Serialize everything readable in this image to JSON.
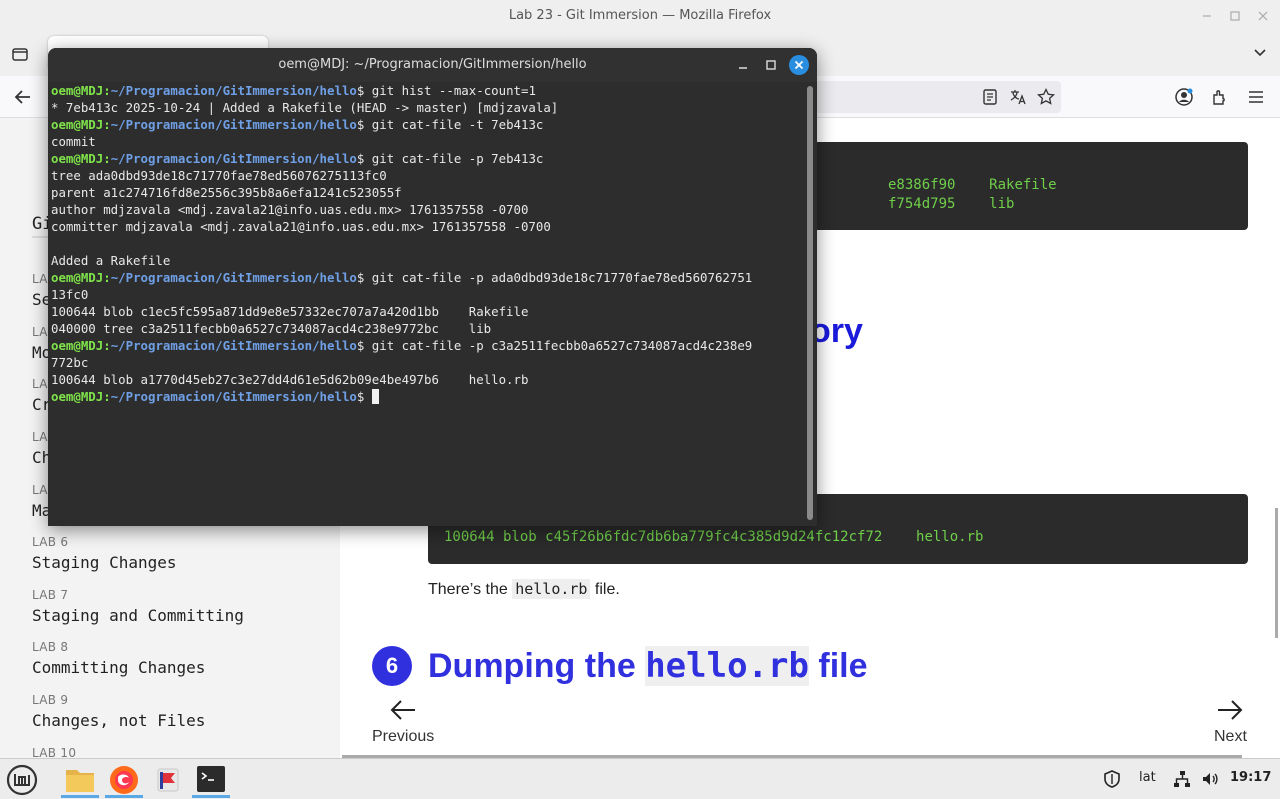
{
  "window": {
    "title": "Lab 23 - Git Immersion — Mozilla Firefox"
  },
  "sidebar": {
    "heading": "Gi",
    "labs": [
      {
        "num": "LAB 1",
        "name": "Se"
      },
      {
        "num": "LAB 2",
        "name": "Mo"
      },
      {
        "num": "LAB 3",
        "name": "Cr"
      },
      {
        "num": "LAB 4",
        "name": "Ch"
      },
      {
        "num": "LAB 5",
        "name": "Ma"
      },
      {
        "num": "LAB 6",
        "name": "Staging Changes"
      },
      {
        "num": "LAB 7",
        "name": "Staging and Committing"
      },
      {
        "num": "LAB 8",
        "name": "Committing Changes"
      },
      {
        "num": "LAB 9",
        "name": "Changes, not Files"
      },
      {
        "num": "LAB 10",
        "name": ""
      }
    ]
  },
  "content": {
    "top_code": {
      "line1_hash": "e8386f90",
      "line1_name": "Rakefile",
      "line2_hash": "f754d795",
      "line2_name": "lib"
    },
    "heading_partial": "ory",
    "mid_code": {
      "line": "100644 blob c45f26b6fdc7db6ba779fc4c385d9d24fc12cf72",
      "name": "hello.rb"
    },
    "para_before": "There’s the ",
    "para_code": "hello.rb",
    "para_after": " file.",
    "section_number": "6",
    "section_title_a": "Dumping the ",
    "section_title_code": "hello.rb",
    "section_title_b": " file",
    "pager": {
      "previous": "Previous",
      "next": "Next"
    }
  },
  "terminal": {
    "title": "oem@MDJ: ~/Programacion/GitImmersion/hello",
    "prompt_user": "oem@MDJ",
    "prompt_path": "~/Programacion/GitImmersion/hello",
    "lines": [
      {
        "type": "cmd",
        "text": "$ git hist --max-count=1"
      },
      {
        "type": "out",
        "text": "* 7eb413c 2025-10-24 | Added a Rakefile (HEAD -> master) [mdjzavala]"
      },
      {
        "type": "cmd",
        "text": "$ git cat-file -t 7eb413c"
      },
      {
        "type": "out",
        "text": "commit"
      },
      {
        "type": "cmd",
        "text": "$ git cat-file -p 7eb413c"
      },
      {
        "type": "out",
        "text": "tree ada0dbd93de18c71770fae78ed56076275113fc0"
      },
      {
        "type": "out",
        "text": "parent a1c274716fd8e2556c395b8a6efa1241c523055f"
      },
      {
        "type": "out",
        "text": "author mdjzavala <mdj.zavala21@info.uas.edu.mx> 1761357558 -0700"
      },
      {
        "type": "out",
        "text": "committer mdjzavala <mdj.zavala21@info.uas.edu.mx> 1761357558 -0700"
      },
      {
        "type": "out",
        "text": ""
      },
      {
        "type": "out",
        "text": "Added a Rakefile"
      },
      {
        "type": "cmd",
        "text": "$ git cat-file -p ada0dbd93de18c71770fae78ed560762751"
      },
      {
        "type": "out",
        "text": "13fc0"
      },
      {
        "type": "out",
        "text": "100644 blob c1ec5fc595a871dd9e8e57332ec707a7a420d1bb    Rakefile"
      },
      {
        "type": "out",
        "text": "040000 tree c3a2511fecbb0a6527c734087acd4c238e9772bc    lib"
      },
      {
        "type": "cmd",
        "text": "$ git cat-file -p c3a2511fecbb0a6527c734087acd4c238e9"
      },
      {
        "type": "out",
        "text": "772bc"
      },
      {
        "type": "out",
        "text": "100644 blob a1770d45eb27c3e27dd4d61e5d62b09e4be497b6    hello.rb"
      },
      {
        "type": "cmd",
        "text": "$ "
      }
    ]
  },
  "taskbar": {
    "layout": "lat",
    "clock": "19:17"
  },
  "colors": {
    "link_heading": "#1a1adb",
    "terminal_user": "#7fe34a",
    "terminal_path": "#6fa0e6",
    "code_text": "#6fcf4a",
    "close_button": "#2a8ee0"
  }
}
